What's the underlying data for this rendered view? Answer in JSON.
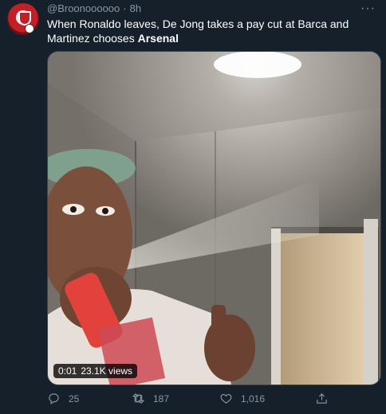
{
  "tweet": {
    "handle": "@Broonoooooo",
    "separator": "·",
    "time": "8h",
    "more_label": "···",
    "text_plain": "When Ronaldo leaves, De Jong takes a pay cut at Barca and Martinez chooses ",
    "text_bold": "Arsenal"
  },
  "media": {
    "time": "0:01",
    "views": "23.1K views"
  },
  "actions": {
    "reply": {
      "icon": "reply-icon",
      "count": "25"
    },
    "retweet": {
      "icon": "retweet-icon",
      "count": "187"
    },
    "like": {
      "icon": "heart-icon",
      "count": "1,016"
    },
    "share": {
      "icon": "share-icon"
    }
  },
  "colors": {
    "background": "#15202b",
    "secondary_text": "#8899a6",
    "primary_text": "#ffffff"
  }
}
